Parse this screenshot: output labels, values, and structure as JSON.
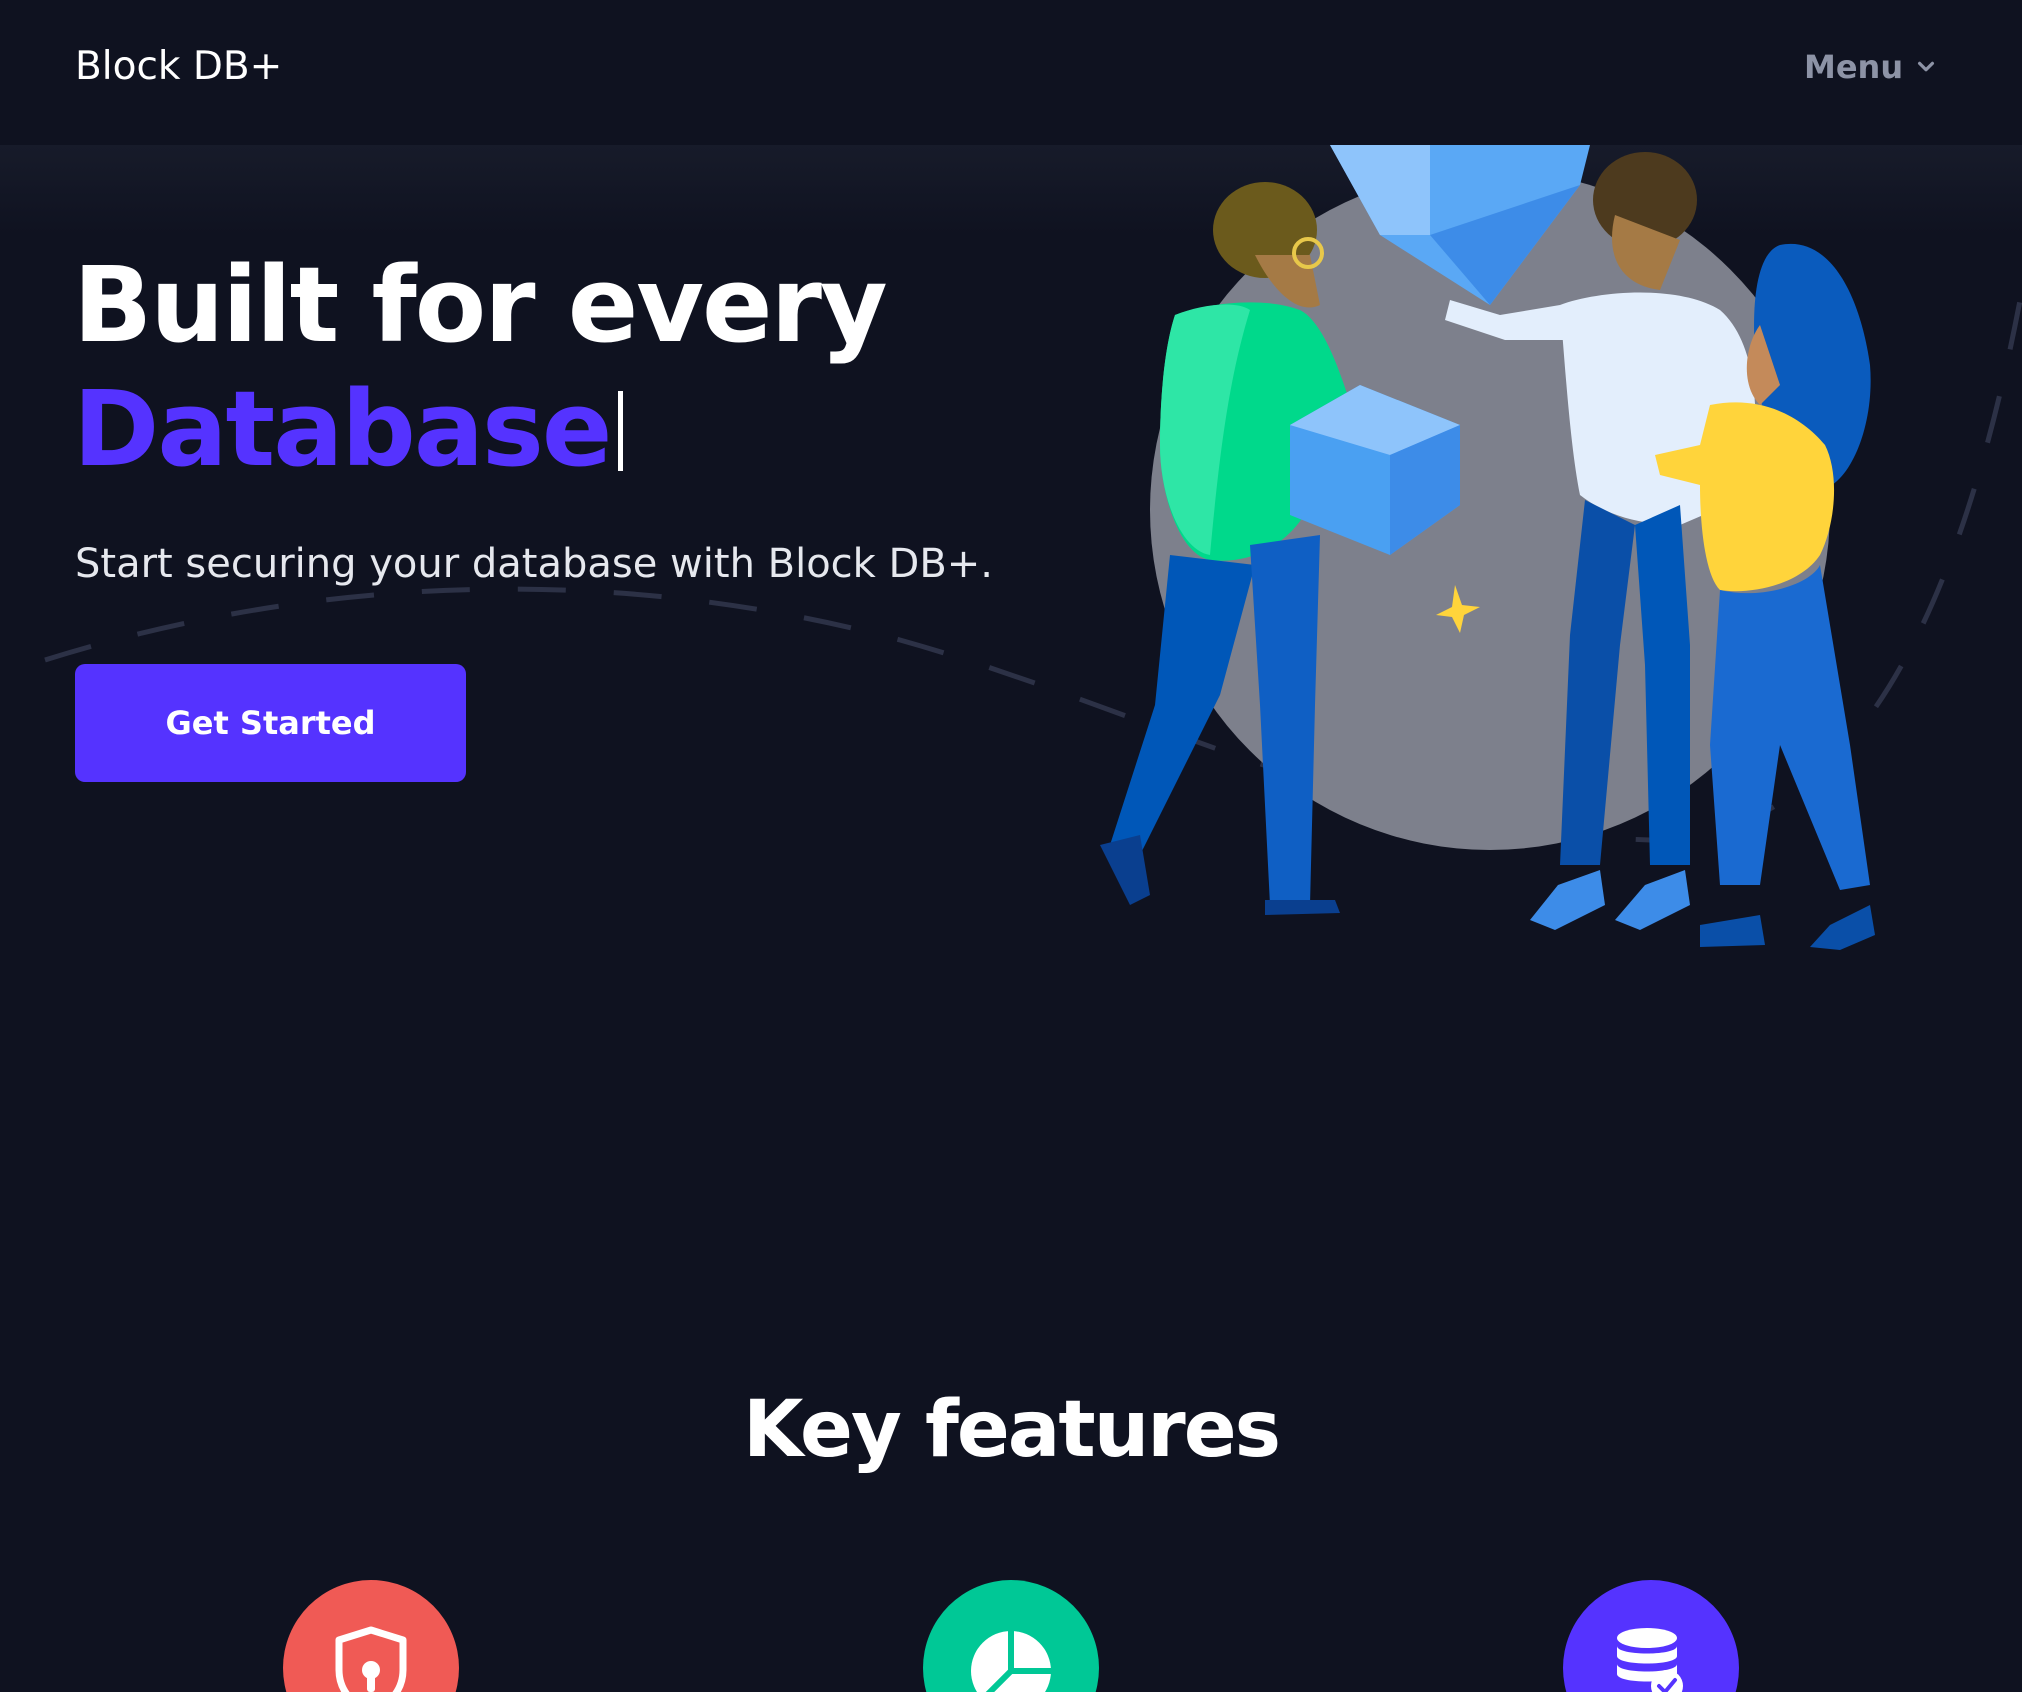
{
  "header": {
    "logo": "Block DB+",
    "menu_label": "Menu"
  },
  "hero": {
    "headline_line1": "Built for every",
    "headline_accent": "Database",
    "subtext": "Start securing your database with Block DB+.",
    "cta_label": "Get Started"
  },
  "features": {
    "title": "Key features",
    "items": [
      {
        "icon": "shield-lock-icon",
        "color": "#f05a55"
      },
      {
        "icon": "pie-chart-icon",
        "color": "#00c896"
      },
      {
        "icon": "database-check-icon",
        "color": "#5533ff"
      }
    ]
  },
  "colors": {
    "background": "#0f1220",
    "accent": "#5533ff",
    "menu_text": "#8d93a6"
  }
}
